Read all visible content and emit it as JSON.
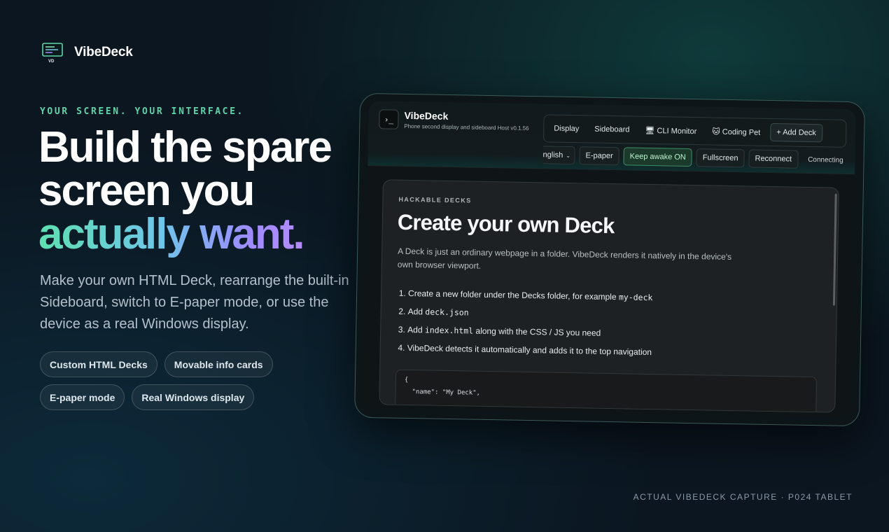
{
  "brand": {
    "name": "VibeDeck",
    "mark_label": "VD"
  },
  "hero": {
    "tagline": "YOUR SCREEN. YOUR INTERFACE.",
    "line1": "Build the spare",
    "line2": "screen you",
    "line3": "actually want.",
    "sub": "Make your own HTML Deck, rearrange the built-in Sideboard, switch to E-paper mode, or use the device as a real Windows display.",
    "chips": [
      "Custom HTML Decks",
      "Movable info cards",
      "E-paper mode",
      "Real Windows display"
    ]
  },
  "caption": "ACTUAL VIBEDECK CAPTURE · P024 TABLET",
  "app": {
    "icon": "›_",
    "title": "VibeDeck",
    "subtitle": "Phone second display and sideboard Host v0.1.56",
    "nav": {
      "display": "Display",
      "sideboard": "Sideboard",
      "cli": "🖥 CLI Monitor",
      "pet": "🐱 Coding Pet",
      "add": "+ Add Deck"
    },
    "controls": {
      "language": "nglish",
      "epaper": "E-paper",
      "keep_awake": "Keep awake ON",
      "fullscreen": "Fullscreen",
      "reconnect": "Reconnect",
      "status": "Connecting"
    },
    "content": {
      "kicker": "HACKABLE DECKS",
      "title": "Create your own Deck",
      "desc": "A Deck is just an ordinary webpage in a folder. VibeDeck renders it natively in the device's own browser viewport.",
      "step1_text": "Create a new folder under the Decks folder, for example",
      "step1_code": "my-deck",
      "step2_text": "Add",
      "step2_code": "deck.json",
      "step3_text": "Add",
      "step3_code": "index.html",
      "step3_rest": "along with the CSS / JS you need",
      "step4_text": "VibeDeck detects it automatically and adds it to the top navigation",
      "code": "{\n  \"name\": \"My Deck\","
    }
  },
  "colors": {
    "accent_green": "#5fd3a8",
    "accent_purple": "#b58cff",
    "bg": "#0b1620"
  }
}
